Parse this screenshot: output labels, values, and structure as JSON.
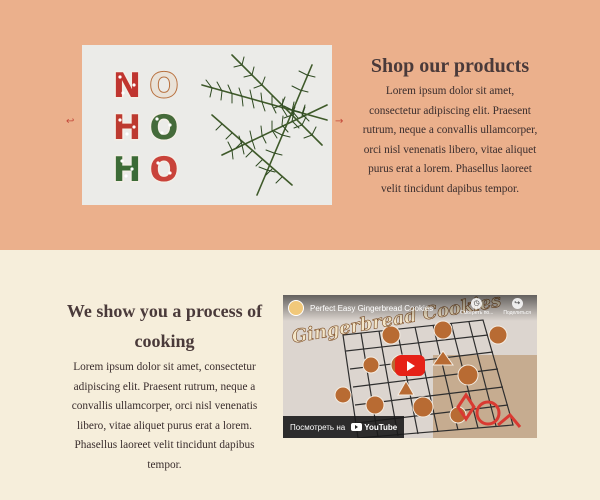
{
  "shop": {
    "title": "Shop our products",
    "body": "Lorem ipsum dolor sit amet, consectetur adipiscing elit. Praesent rutrum, neque a convallis ullamcorper, orci nisl venenatis libero, vitae aliquet purus erat a lorem. Phasellus laoreet velit tincidunt dapibus tempor.",
    "prev_arrow": "↩",
    "next_arrow": "→",
    "image_letters": [
      "N",
      "O",
      "H",
      "O",
      "H",
      "O"
    ]
  },
  "process": {
    "title": "We show you a process of cooking",
    "body": "Lorem ipsum dolor sit amet, consectetur adipiscing elit. Praesent rutrum, neque a convallis ullamcorper, orci nisl venenatis libero, vitae aliquet purus erat a lorem. Phasellus laoreet velit tincidunt dapibus tempor."
  },
  "video": {
    "title": "Perfect Easy Gingerbread Cookies",
    "overlay_text": "Gingerbread Cookies",
    "watch_later": "Смотреть по...",
    "share": "Поделиться",
    "watch_on": "Посмотреть на",
    "youtube": "YouTube"
  },
  "colors": {
    "shop_bg": "#ebb08c",
    "process_bg": "#f6eedb",
    "accent_red": "#c44a3a",
    "text_dark": "#4a3a3a"
  }
}
